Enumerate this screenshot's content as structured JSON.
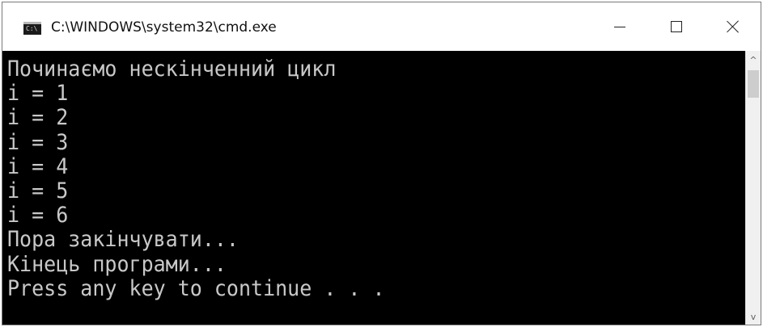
{
  "window": {
    "title": "C:\\WINDOWS\\system32\\cmd.exe",
    "icon": "cmd-console-icon",
    "icon_prompt": "C:\\",
    "controls": {
      "minimize_icon": "minimize-icon",
      "maximize_icon": "maximize-icon",
      "close_icon": "close-icon"
    }
  },
  "console": {
    "lines": [
      "Починаємо нескінченний цикл",
      "i = 1",
      "i = 2",
      "i = 3",
      "i = 4",
      "i = 5",
      "i = 6",
      "Пора закінчувати...",
      "Кінець програми...",
      "Press any key to continue . . ."
    ]
  },
  "scrollbar": {
    "up_arrow": "^",
    "down_arrow": "v"
  },
  "colors": {
    "console_background": "#000000",
    "console_text": "#c8c8c8",
    "titlebar_background": "#ffffff"
  }
}
